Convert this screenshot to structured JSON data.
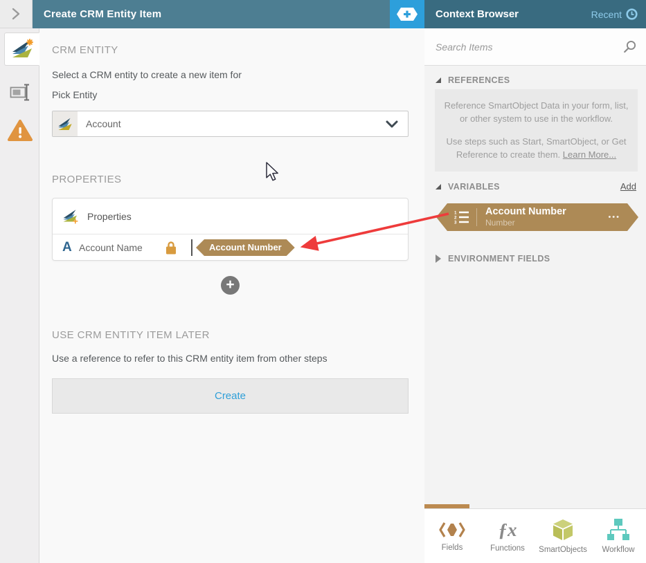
{
  "header": {
    "title": "Create CRM Entity Item",
    "context_title": "Context Browser",
    "recent_label": "Recent"
  },
  "main": {
    "crm_entity": {
      "heading": "CRM ENTITY",
      "description": "Select a CRM entity to create a new item for",
      "pick_label": "Pick Entity",
      "selected_entity": "Account"
    },
    "properties": {
      "heading": "PROPERTIES",
      "card_title": "Properties",
      "row": {
        "letter_icon": "A",
        "label": "Account Name",
        "value_tag": "Account Number"
      }
    },
    "later": {
      "heading": "USE CRM ENTITY ITEM LATER",
      "description": "Use a reference to refer to this CRM entity item from other steps",
      "create_label": "Create"
    }
  },
  "context": {
    "search": {
      "placeholder": "Search Items"
    },
    "references": {
      "heading": "REFERENCES",
      "info_line1": "Reference SmartObject Data in your form, list, or other system to use in the workflow.",
      "info_line2": "Use steps such as Start, SmartObject, or Get Reference to create them.",
      "learn_more": "Learn More..."
    },
    "variables": {
      "heading": "VARIABLES",
      "add_label": "Add",
      "item": {
        "name": "Account Number",
        "type": "Number"
      }
    },
    "environment": {
      "heading": "ENVIRONMENT FIELDS"
    },
    "tabs": [
      {
        "label": "Fields"
      },
      {
        "label": "Functions"
      },
      {
        "label": "SmartObjects"
      },
      {
        "label": "Workflow"
      }
    ]
  },
  "icons": {
    "plus": "+",
    "ellipsis": "•••",
    "functions_glyph": "ƒx"
  },
  "colors": {
    "header_teal": "#4d7e92",
    "context_header_teal": "#396b80",
    "accent_blue": "#2d9fdb",
    "bronze": "#ad8a56",
    "tab_indicator_bronze": "#bc8a50",
    "arrow_red": "#ee3b3b",
    "warning_orange": "#e09440",
    "smartobjects_olive": "#c3c868",
    "workflow_teal": "#5ec9be",
    "create_link_blue": "#2f9fd8",
    "recent_blue": "#8ecbea"
  }
}
